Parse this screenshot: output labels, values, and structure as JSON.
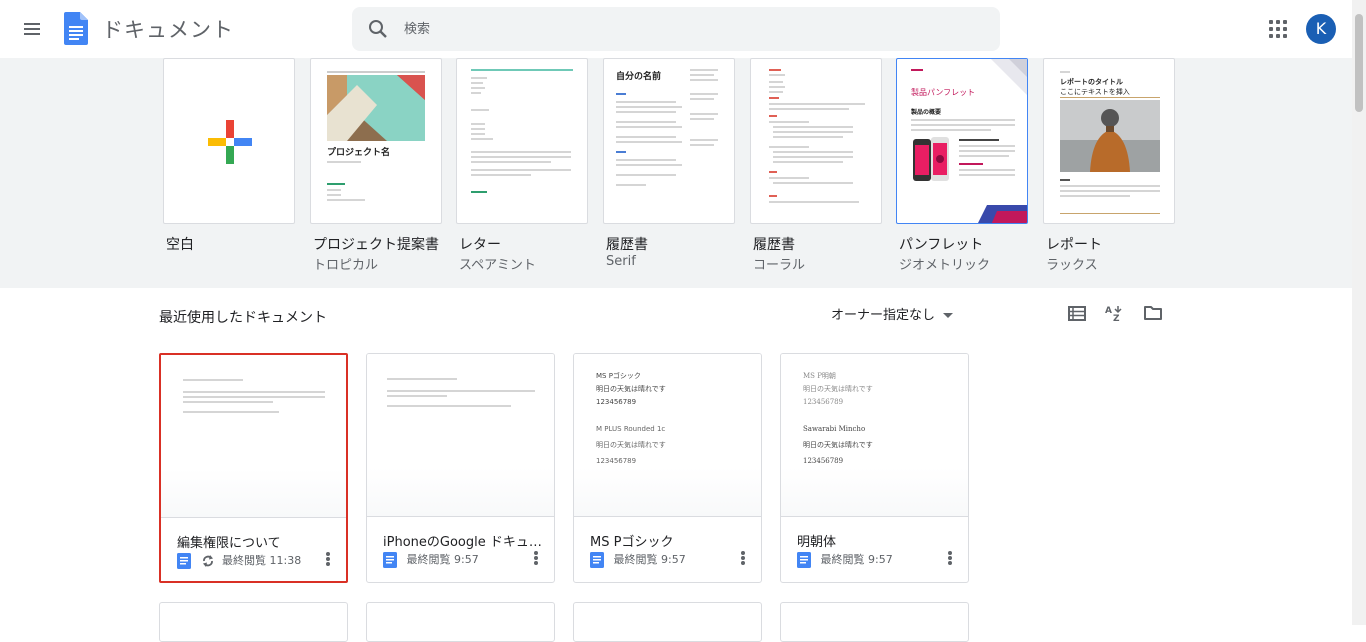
{
  "app": {
    "title": "ドキュメント",
    "avatar_letter": "K"
  },
  "search": {
    "placeholder": "検索"
  },
  "templates": [
    {
      "name": "空白",
      "sub": ""
    },
    {
      "name": "プロジェクト提案書",
      "sub": "トロピカル",
      "thumb_title": "プロジェクト名"
    },
    {
      "name": "レター",
      "sub": "スペアミント"
    },
    {
      "name": "履歴書",
      "sub": "Serif",
      "thumb_title": "自分の名前"
    },
    {
      "name": "履歴書",
      "sub": "コーラル"
    },
    {
      "name": "パンフレット",
      "sub": "ジオメトリック",
      "thumb_title": "製品パンフレット",
      "thumb_sub": "製品の概要"
    },
    {
      "name": "レポート",
      "sub": "ラックス",
      "thumb_title": "レポートのタイトル",
      "thumb_sub": "ここにテキストを挿入"
    }
  ],
  "recent": {
    "title": "最近使用したドキュメント",
    "owner_filter": "オーナー指定なし"
  },
  "documents": [
    {
      "title": "編集権限について",
      "meta": "最終閲覧 11:38",
      "preview_lines": []
    },
    {
      "title": "iPhoneのGoogle ドキュメ...",
      "meta": "最終閲覧 9:57",
      "preview_lines": []
    },
    {
      "title": "MS Pゴシック",
      "meta": "最終閲覧 9:57",
      "preview_lines": [
        "MS Pゴシック",
        "明日の天気は晴れです",
        "123456789",
        "M PLUS Rounded 1c",
        "明日の天気は晴れです",
        "123456789"
      ]
    },
    {
      "title": "明朝体",
      "meta": "最終閲覧 9:57",
      "preview_lines": [
        "MS P明朝",
        "明日の天気は晴れです",
        "123456789",
        "Sawarabi Mincho",
        "明日の天気は晴れです",
        "123456789"
      ]
    }
  ],
  "colors": {
    "accent_blue": "#4285f4",
    "selected_red": "#d93025",
    "strip_bg": "#f1f3f4"
  },
  "icons": [
    "menu-icon",
    "docs-logo-icon",
    "search-icon",
    "apps-grid-icon",
    "list-view-icon",
    "sort-az-icon",
    "folder-icon",
    "doc-icon",
    "shared-sync-icon",
    "more-vert-icon"
  ]
}
